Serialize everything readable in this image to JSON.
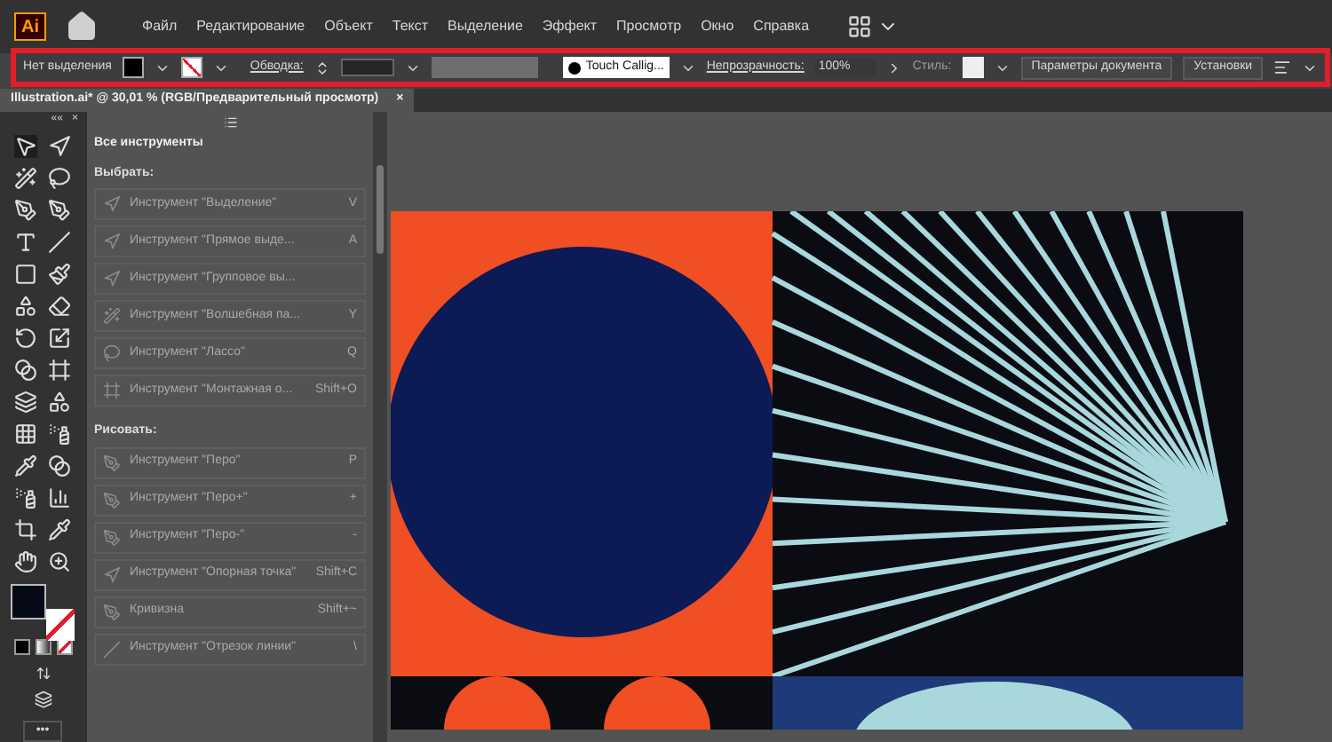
{
  "menu_bar": {
    "logo": "Ai",
    "items": [
      "Файл",
      "Редактирование",
      "Объект",
      "Текст",
      "Выделение",
      "Эффект",
      "Просмотр",
      "Окно",
      "Справка"
    ]
  },
  "control_bar": {
    "selection_label": "Нет выделения",
    "stroke_label": "Обводка:",
    "brush": "Touch Callig...",
    "opacity_label": "Непрозрачность:",
    "opacity_value": "100%",
    "style_label": "Стиль:",
    "buttons": [
      "Параметры документа",
      "Установки"
    ]
  },
  "document_tab": {
    "title": "Illustration.ai* @ 30,01 % (RGB/Предварительный просмотр)",
    "close": "×"
  },
  "tools_panel": {
    "close": "×",
    "collapse": "««"
  },
  "all_tools_panel": {
    "title": "Все инструменты",
    "sections": [
      {
        "title": "Выбрать:",
        "items": [
          {
            "label": "Инструмент \"Выделение\"",
            "shortcut": "V"
          },
          {
            "label": "Инструмент \"Прямое выде...",
            "shortcut": "A"
          },
          {
            "label": "Инструмент \"Групповое вы..."
          },
          {
            "label": "Инструмент \"Волшебная па...",
            "shortcut": "Y"
          },
          {
            "label": "Инструмент \"Лассо\"",
            "shortcut": "Q"
          },
          {
            "label": "Инструмент \"Монтажная о...",
            "shortcut": "Shift+O"
          }
        ]
      },
      {
        "title": "Рисовать:",
        "items": [
          {
            "label": "Инструмент \"Перо\"",
            "shortcut": "P"
          },
          {
            "label": "Инструмент \"Перо+\"",
            "shortcut": "+"
          },
          {
            "label": "Инструмент \"Перо-\"",
            "shortcut": "-"
          },
          {
            "label": "Инструмент \"Опорная точка\"",
            "shortcut": "Shift+C"
          },
          {
            "label": "Кривизна",
            "shortcut": "Shift+~"
          },
          {
            "label": "Инструмент \"Отрезок линии\"",
            "shortcut": "\\"
          }
        ]
      }
    ]
  },
  "more_tools": "•••"
}
